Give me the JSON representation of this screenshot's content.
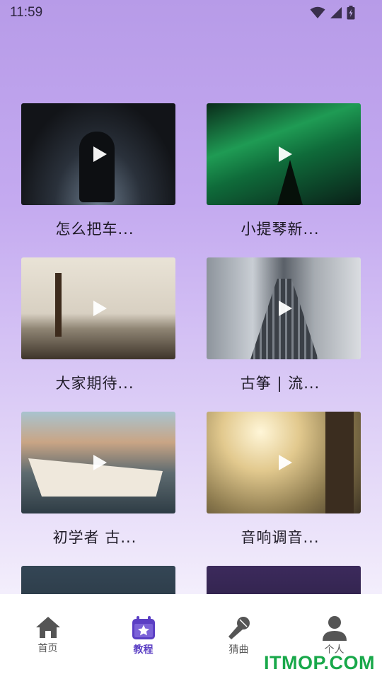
{
  "status": {
    "time": "11:59"
  },
  "videos": [
    {
      "title": "怎么把车...",
      "scene": "night"
    },
    {
      "title": "小提琴新...",
      "scene": "aurora"
    },
    {
      "title": "大家期待...",
      "scene": "shore"
    },
    {
      "title": "古筝 | 流...",
      "scene": "building"
    },
    {
      "title": "初学者 古...",
      "scene": "boat"
    },
    {
      "title": "音响调音...",
      "scene": "field"
    },
    {
      "title": "",
      "scene": "sparkler"
    },
    {
      "title": "",
      "scene": "bridge"
    }
  ],
  "tabbar": {
    "tabs": [
      {
        "label": "首页",
        "icon": "home-icon",
        "active": false
      },
      {
        "label": "教程",
        "icon": "calendar-star-icon",
        "active": true
      },
      {
        "label": "猜曲",
        "icon": "microphone-icon",
        "active": false
      },
      {
        "label": "个人",
        "icon": "person-icon",
        "active": false
      }
    ]
  },
  "watermark": "ITMOP.COM",
  "colors": {
    "accent": "#5b3fc4",
    "tab_inactive": "#5a5a5a",
    "watermark": "#18a84a"
  }
}
